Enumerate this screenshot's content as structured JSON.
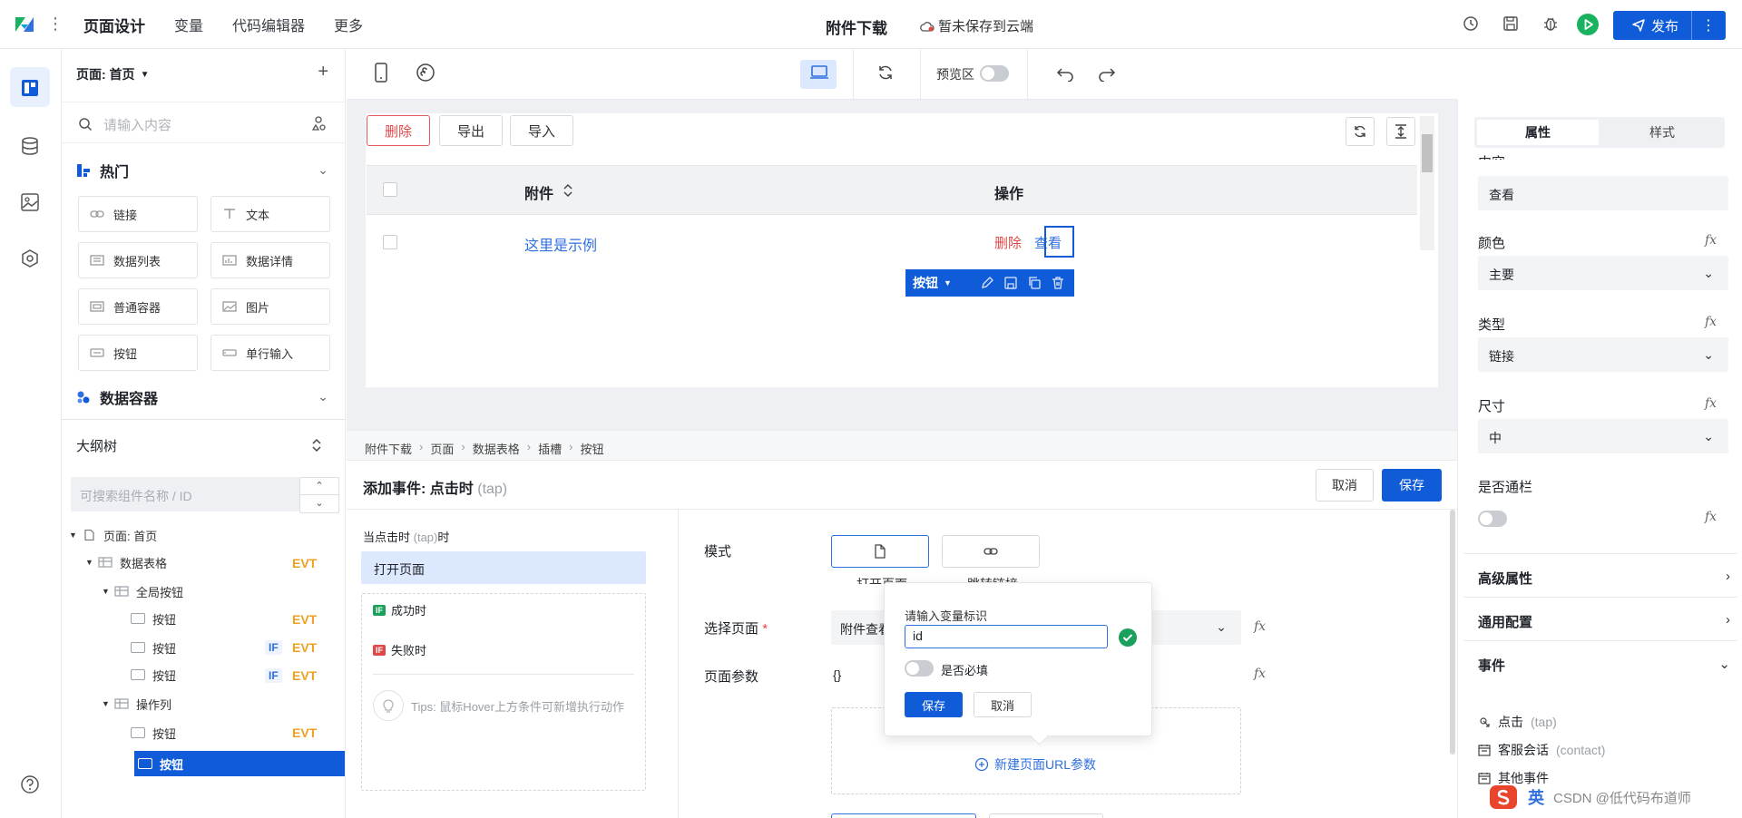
{
  "topbar": {
    "nav": [
      "页面设计",
      "变量",
      "代码编辑器",
      "更多"
    ],
    "doc_title": "附件下载",
    "cloud_status": "暂未保存到云端",
    "publish": "发布"
  },
  "rail": {
    "items": [
      "page-design",
      "database",
      "image",
      "component-settings",
      "help"
    ]
  },
  "components": {
    "page_selector": "页面: 首页",
    "search_placeholder": "请输入内容",
    "hot_title": "热门",
    "items": [
      "链接",
      "文本",
      "数据列表",
      "数据详情",
      "普通容器",
      "图片",
      "按钮",
      "单行输入"
    ],
    "data_container_title": "数据容器"
  },
  "outline": {
    "title": "大纲树",
    "search_placeholder": "可搜索组件名称 / ID",
    "nodes": [
      "页面: 首页",
      "数据表格",
      "全局按钮",
      "按钮",
      "按钮",
      "按钮",
      "操作列",
      "按钮",
      "按钮"
    ],
    "tag_evt": "EVT",
    "tag_if": "IF"
  },
  "toolbar": {
    "preview_label": "预览区"
  },
  "canvas": {
    "buttons": [
      "删除",
      "导出",
      "导入"
    ],
    "columns": [
      "附件",
      "操作"
    ],
    "row": {
      "name": "这里是示例",
      "delete": "删除",
      "view": "查看"
    },
    "selected_bar_label": "按钮"
  },
  "breadcrumb": [
    "附件下载",
    "页面",
    "数据表格",
    "插槽",
    "按钮"
  ],
  "event": {
    "title": "添加事件: 点击时",
    "title_code": "(tap)",
    "cancel": "取消",
    "save": "保存",
    "trigger_prefix": "当点击时",
    "trigger_code": "(tap)",
    "trigger_suffix": "时",
    "action": "打开页面",
    "success": "成功时",
    "fail": "失败时",
    "tips": "Tips: 鼠标Hover上方条件可新增执行动作",
    "mode_label": "模式",
    "mode_opt1": "打开页面",
    "mode_opt2": "跳转链接",
    "select_page_label": "选择页面",
    "select_page_value": "附件查看",
    "params_label": "页面参数",
    "params_value": "{}",
    "new_param": "新建页面URL参数"
  },
  "popover": {
    "label": "请输入变量标识",
    "input_value": "id",
    "required_label": "是否必填",
    "save": "保存",
    "cancel": "取消"
  },
  "props": {
    "tab_attr": "属性",
    "tab_style": "样式",
    "content_label": "内容",
    "content_value": "查看",
    "color_label": "颜色",
    "color_value": "主要",
    "type_label": "类型",
    "type_value": "链接",
    "size_label": "尺寸",
    "size_value": "中",
    "fullwidth_label": "是否通栏",
    "sec_advanced": "高级属性",
    "sec_common": "通用配置",
    "sec_events": "事件",
    "events": [
      {
        "name": "点击",
        "code": "(tap)"
      },
      {
        "name": "客服会话",
        "code": "(contact)"
      },
      {
        "name": "其他事件",
        "code": ""
      }
    ]
  },
  "watermark": {
    "ime": "英",
    "text": "CSDN @低代码布道师"
  },
  "colors": {
    "primary": "#0f5bd8",
    "evt": "#f0a020",
    "danger": "#e04848",
    "success": "#19b35f"
  }
}
